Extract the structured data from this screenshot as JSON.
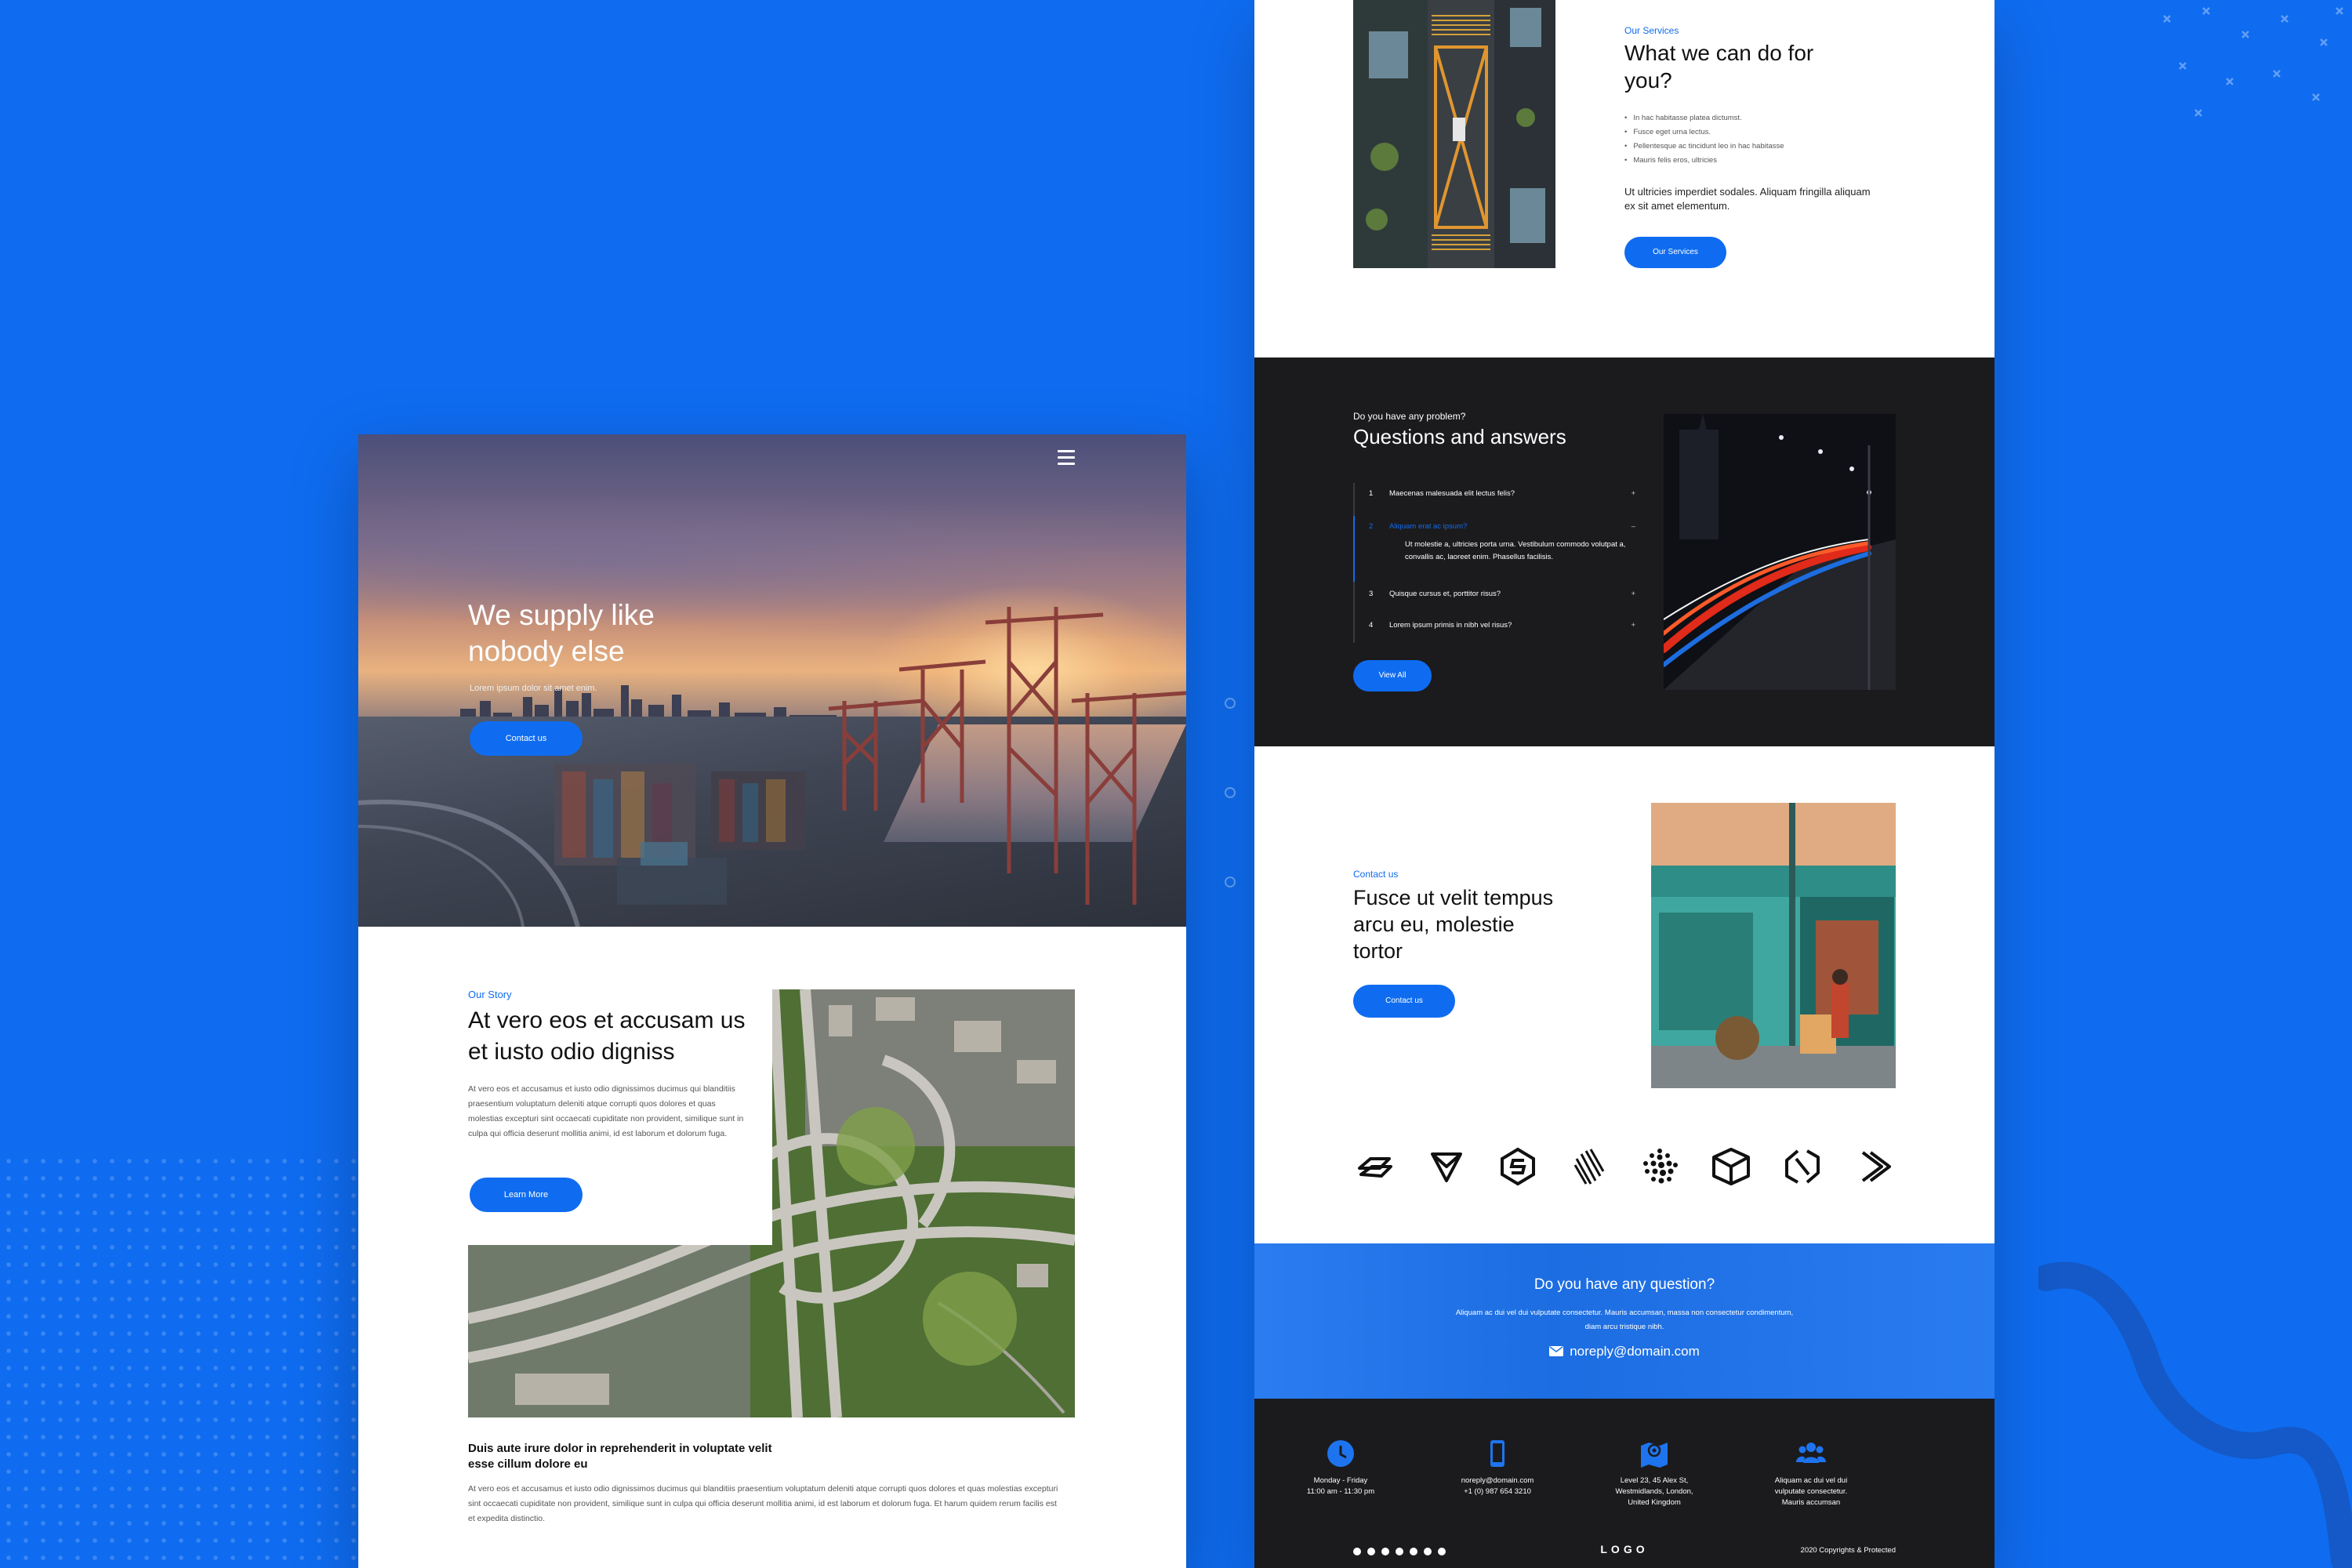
{
  "colors": {
    "brand_blue": "#0f6cf0",
    "dark": "#1b1b1e",
    "white": "#ffffff"
  },
  "left_page": {
    "hero": {
      "menu_icon": "hamburger-icon",
      "title": "We supply like nobody else",
      "subtitle": "Lorem ipsum dolor sit amet enim.",
      "button_label": "Contact us"
    },
    "story": {
      "kicker": "Our Story",
      "title": "At vero eos et accusam us et iusto odio digniss",
      "body": "At vero eos et accusamus et iusto odio dignissimos ducimus qui blanditiis praesentium voluptatum deleniti atque corrupti quos dolores et quas molestias excepturi sint occaecati cupiditate non provident, similique sunt in culpa qui officia deserunt mollitia animi, id est laborum et dolorum fuga.",
      "button_label": "Learn More",
      "subheading": "Duis aute irure dolor in reprehenderit in voluptate velit esse cillum dolore eu",
      "sub_body": "At vero eos et accusamus et iusto odio dignissimos ducimus qui blanditiis praesentium voluptatum deleniti atque corrupti quos dolores et quas molestias excepturi sint occaecati cupiditate non provident, similique sunt in culpa qui officia deserunt mollitia animi, id est laborum et dolorum fuga. Et harum quidem rerum facilis est et expedita distinctio."
    }
  },
  "right_page": {
    "services": {
      "kicker": "Our Services",
      "title": "What we can do for you?",
      "items": [
        "In hac habitasse platea dictumst.",
        "Fusce eget urna lectus.",
        "Pellentesque ac tincidunt leo in hac habitasse",
        "Mauris felis eros, ultricies"
      ],
      "text": "Ut ultricies imperdiet sodales. Aliquam fringilla aliquam ex sit amet elementum.",
      "button_label": "Our Services"
    },
    "faq": {
      "kicker": "Do you have any problem?",
      "title": "Questions and answers",
      "items": [
        {
          "num": "1",
          "question": "Maecenas malesuada elit lectus felis?",
          "sign": "+"
        },
        {
          "num": "2",
          "question": "Aliquam erat ac ipsum?",
          "sign": "–",
          "answer": "Ut molestie a, ultricies porta urna. Vestibulum commodo volutpat a, convallis ac, laoreet enim. Phasellus facilisis."
        },
        {
          "num": "3",
          "question": "Quisque cursus et, porttitor risus?",
          "sign": "+"
        },
        {
          "num": "4",
          "question": "Lorem ipsum primis in nibh vel risus?",
          "sign": "+"
        }
      ],
      "button_label": "View All"
    },
    "contact": {
      "kicker": "Contact us",
      "title": "Fusce ut velit tempus arcu eu, molestie tortor",
      "button_label": "Contact us"
    },
    "partner_logos": [
      "arrow-stack-logo",
      "shield-y-logo",
      "hex-s-logo",
      "striped-diamond-logo",
      "dot-sphere-logo",
      "cube-logo",
      "hex-n-logo",
      "chevron-logo"
    ],
    "question_band": {
      "title": "Do you have any question?",
      "text": "Aliquam ac dui vel dui vulputate consectetur. Mauris accumsan, massa non consectetur condimentum, diam arcu tristique nibh.",
      "email": "noreply@domain.com"
    },
    "footer": {
      "columns": [
        {
          "icon": "clock-icon",
          "lines": [
            "Monday - Friday",
            "11:00 am - 11:30 pm"
          ]
        },
        {
          "icon": "phone-icon",
          "lines": [
            "noreply@domain.com",
            "+1 (0) 987 654 3210"
          ]
        },
        {
          "icon": "map-icon",
          "lines": [
            "Level 23, 45 Alex St,",
            "Westmidlands, London,",
            "United Kingdom"
          ]
        },
        {
          "icon": "users-icon",
          "lines": [
            "Aliquam ac dui vel dui",
            "vulputate consectetur.",
            "Mauris accumsan"
          ]
        }
      ],
      "social": [
        "facebook-icon",
        "twitter-icon",
        "youtube-icon",
        "instagram-icon",
        "pinterest-icon",
        "dribbble-icon",
        "behance-icon"
      ],
      "logo": "LOGO",
      "copyright": "2020 Copyrights & Protected"
    }
  }
}
